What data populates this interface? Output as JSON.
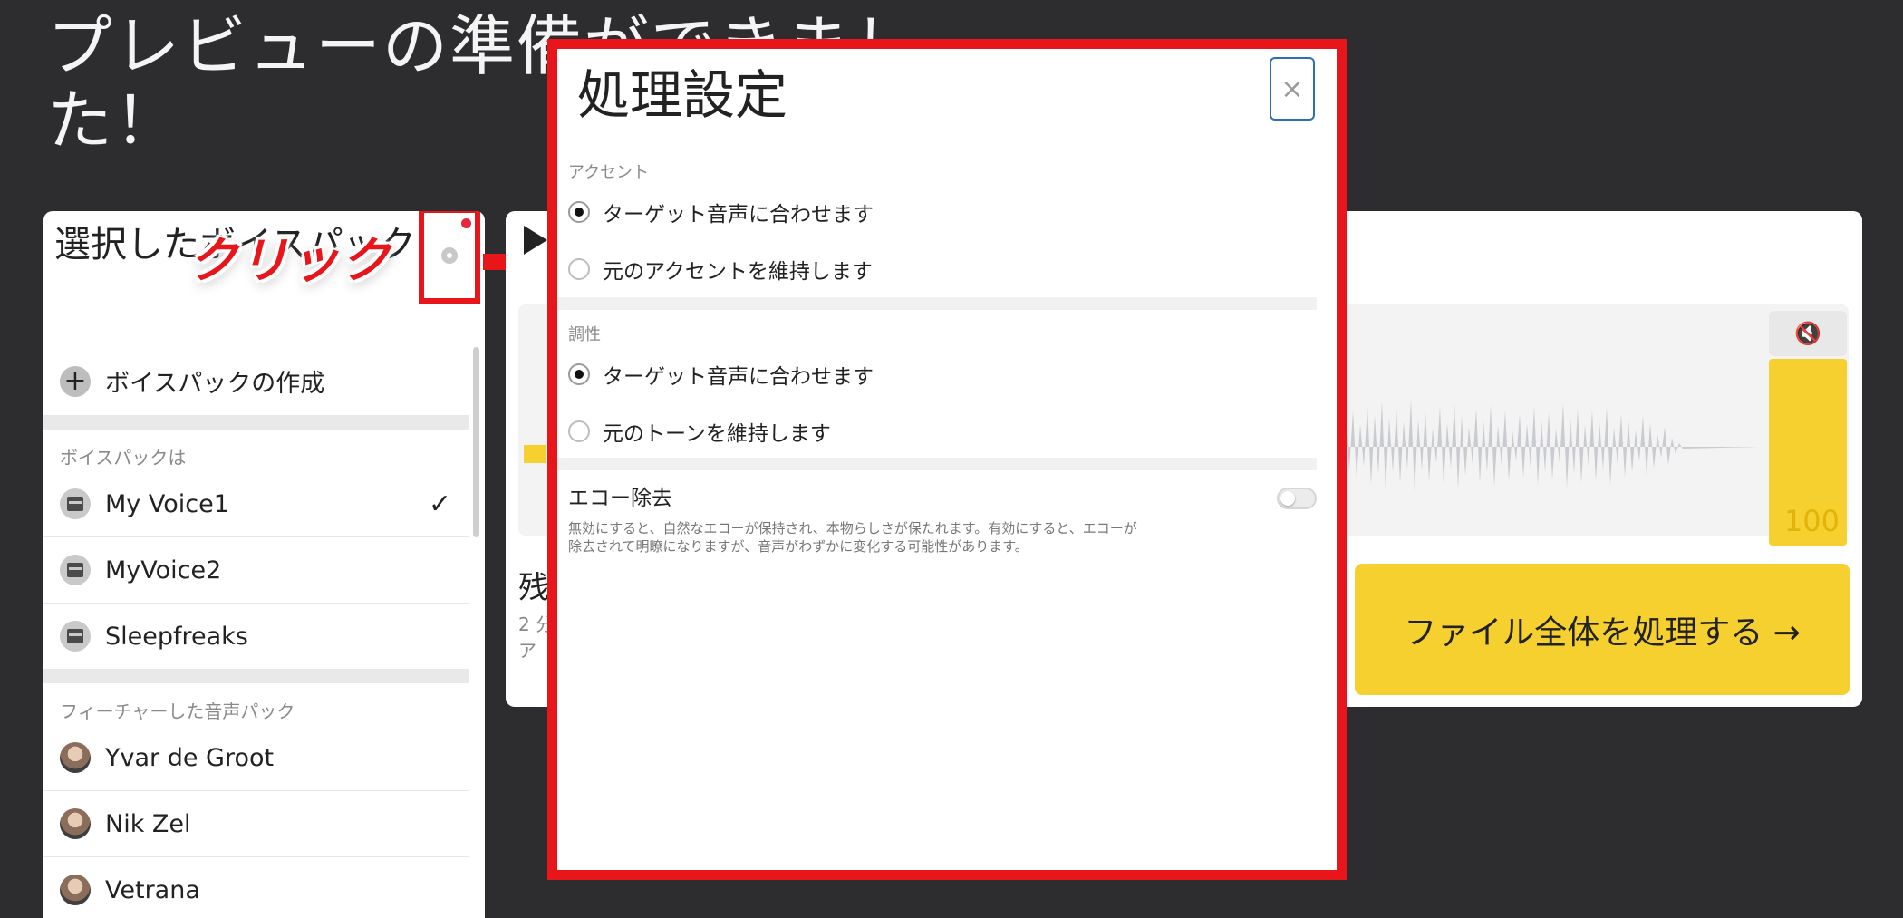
{
  "page": {
    "title": "プレビューの準備ができました！"
  },
  "voice_panel": {
    "title": "選択したボイスパック",
    "click_annotation": "クリック",
    "create_label": "ボイスパックの作成",
    "section_voicepacks": "ボイスパックは",
    "voicepacks": [
      {
        "name": "My Voice1",
        "selected": true
      },
      {
        "name": "MyVoice2",
        "selected": false
      },
      {
        "name": "Sleepfreaks",
        "selected": false
      }
    ],
    "section_featured": "フィーチャーした音声パック",
    "featured": [
      {
        "name": "Yvar de Groot"
      },
      {
        "name": "Nik Zel"
      },
      {
        "name": "Vetrana"
      }
    ]
  },
  "preview_panel": {
    "partial_title": "残",
    "partial_line1": "2 分",
    "partial_line2": "ア",
    "level_value": "100",
    "process_button": "ファイル全体を処理する →",
    "mute_icon": "🔇"
  },
  "modal": {
    "title": "処理設定",
    "close_icon": "×",
    "accent": {
      "label": "アクセント",
      "options": [
        {
          "label": "ターゲット音声に合わせます",
          "checked": true
        },
        {
          "label": "元のアクセントを維持します",
          "checked": false
        }
      ]
    },
    "tone": {
      "label": "調性",
      "options": [
        {
          "label": "ターゲット音声に合わせます",
          "checked": true
        },
        {
          "label": "元のトーンを維持します",
          "checked": false
        }
      ]
    },
    "echo": {
      "title": "エコー除去",
      "description": "無効にすると、自然なエコーが保持され、本物らしさが保たれます。有効にすると、エコーが除去されて明瞭になりますが、音声がわずかに変化する可能性があります。",
      "enabled": false
    }
  },
  "colors": {
    "annotation_red": "#e8161a",
    "accent_yellow": "#f6d02f",
    "background": "#2d2c2f"
  }
}
